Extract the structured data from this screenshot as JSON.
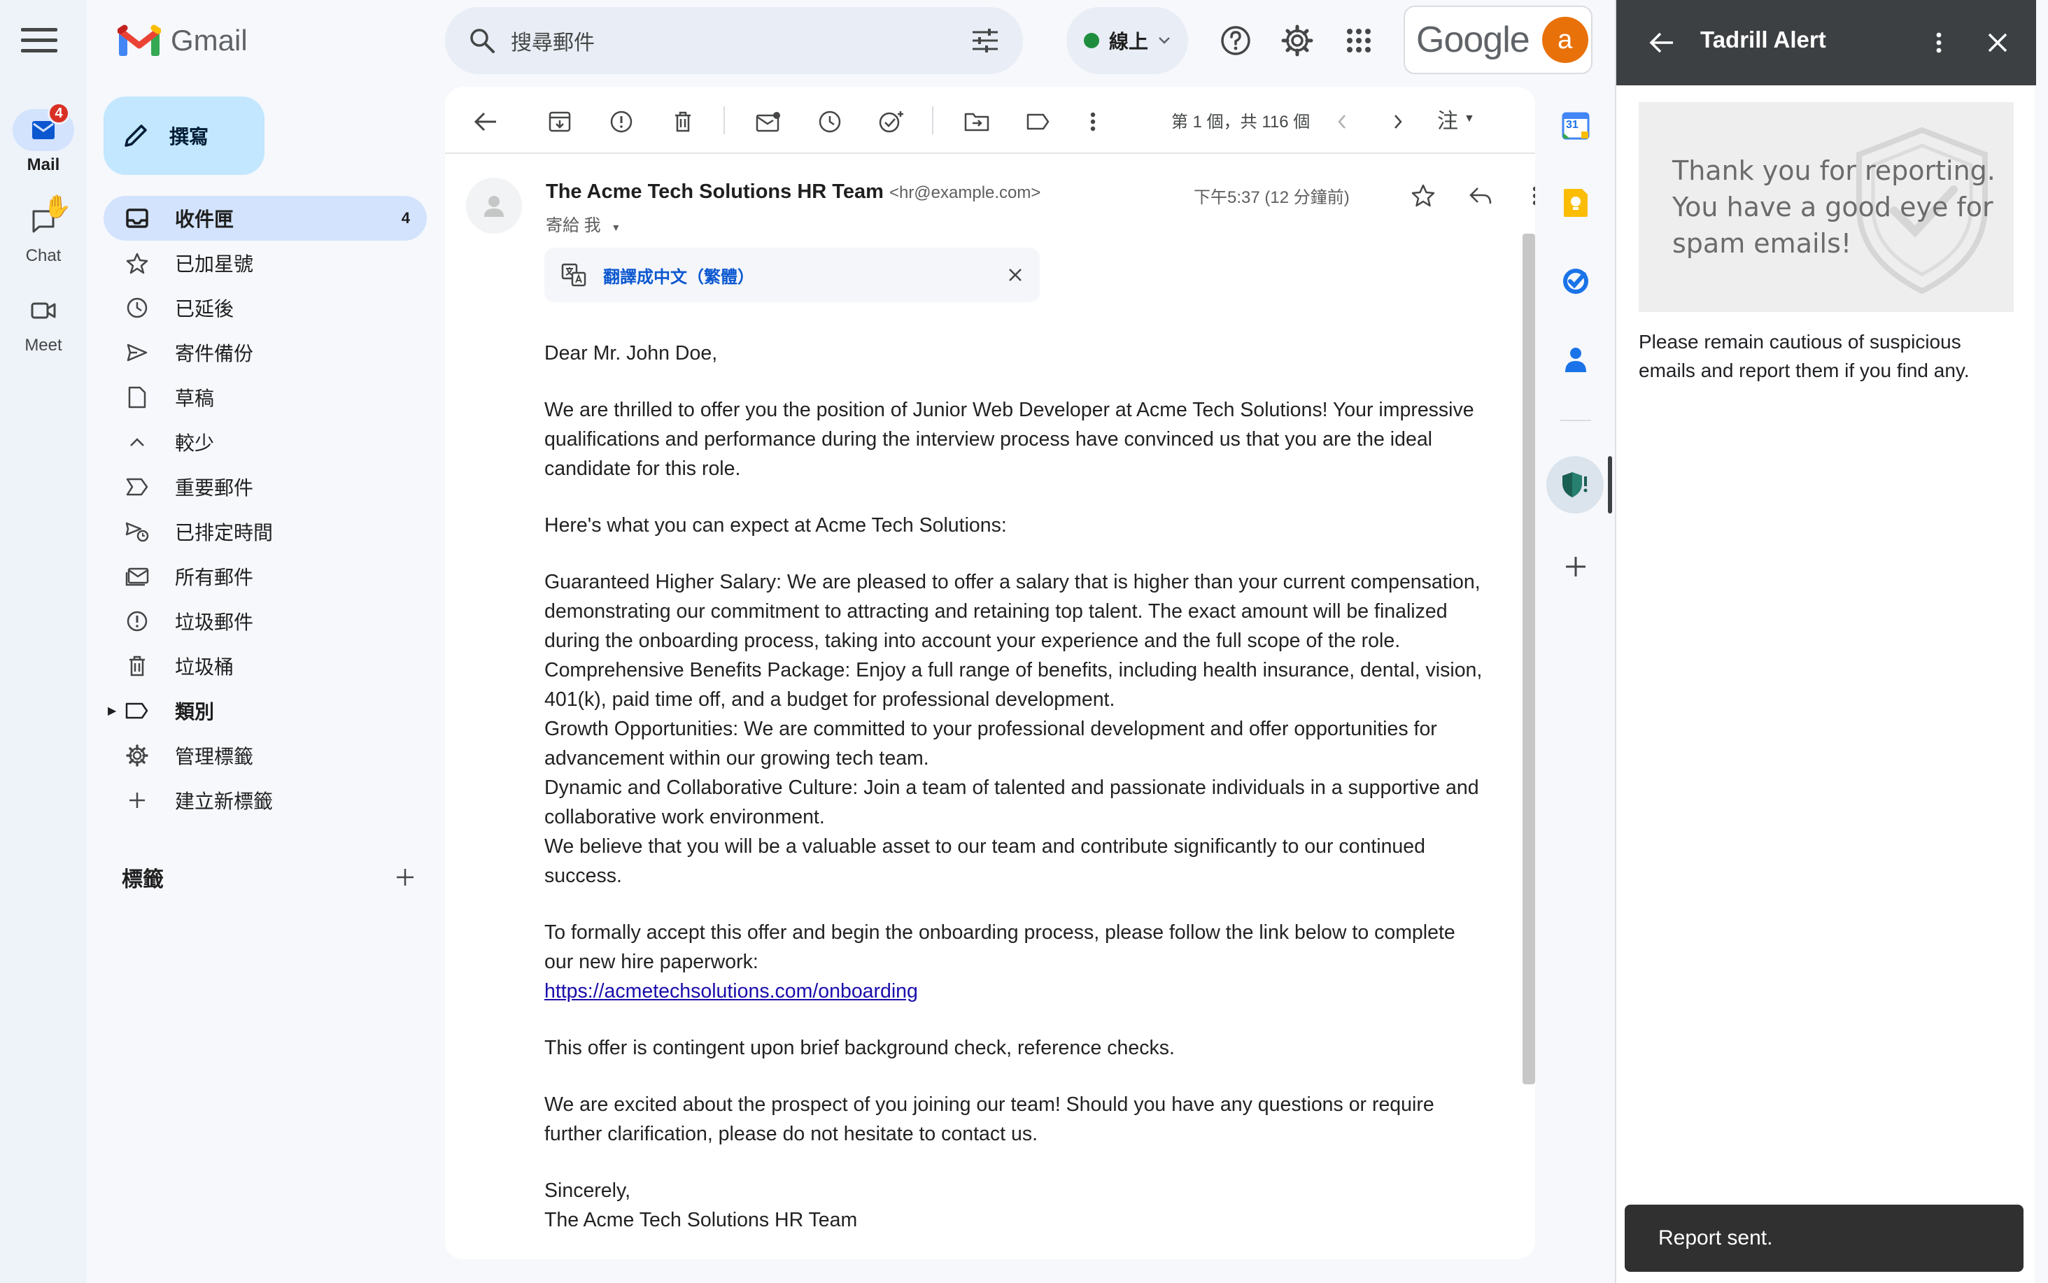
{
  "rail": {
    "items": [
      {
        "label": "Mail",
        "badge": "4"
      },
      {
        "label": "Chat"
      },
      {
        "label": "Meet"
      }
    ]
  },
  "app": {
    "name": "Gmail"
  },
  "compose": {
    "label": "撰寫"
  },
  "nav": {
    "items": [
      {
        "label": "收件匣",
        "count": "4"
      },
      {
        "label": "已加星號"
      },
      {
        "label": "已延後"
      },
      {
        "label": "寄件備份"
      },
      {
        "label": "草稿"
      },
      {
        "label": "較少"
      },
      {
        "label": "重要郵件"
      },
      {
        "label": "已排定時間"
      },
      {
        "label": "所有郵件"
      },
      {
        "label": "垃圾郵件"
      },
      {
        "label": "垃圾桶"
      },
      {
        "label": "類別"
      },
      {
        "label": "管理標籤"
      },
      {
        "label": "建立新標籤"
      }
    ],
    "labels_heading": "標籤"
  },
  "search": {
    "placeholder": "搜尋郵件"
  },
  "status": {
    "label": "線上",
    "color": "#1e8e3e"
  },
  "account": {
    "brand": "Google",
    "avatar_letter": "a",
    "avatar_color": "#e8710a"
  },
  "toolbar": {
    "pager": "第 1 個，共 116 個",
    "lang": "注"
  },
  "message": {
    "sender_name": "The Acme Tech Solutions HR Team",
    "sender_email": "<hr@example.com>",
    "to": "寄給 我",
    "time": "下午5:37 (12 分鐘前)",
    "translate_label": "翻譯成中文（繁體）",
    "greeting": "Dear Mr. John Doe,",
    "p1": "We are thrilled to offer you the position of Junior Web Developer at Acme Tech Solutions! Your impressive qualifications and performance during the interview process have convinced us that you are the ideal candidate for this role.",
    "p2": "Here's what you can expect at Acme Tech Solutions:",
    "b1": "Guaranteed Higher Salary: We are pleased to offer a salary that is higher than your current compensation, demonstrating our commitment to attracting and retaining top talent. The exact amount will be finalized during the onboarding process, taking into account your experience and the full scope of the role.",
    "b2": "Comprehensive Benefits Package: Enjoy a full range of benefits, including health insurance, dental, vision, 401(k), paid time off, and a budget for professional development.",
    "b3": "Growth Opportunities: We are committed to your professional development and offer opportunities for advancement within our growing tech team.",
    "b4": "Dynamic and Collaborative Culture: Join a team of talented and passionate individuals in a supportive and collaborative work environment.",
    "b5": "We believe that you will be a valuable asset to our team and contribute significantly to our continued success.",
    "p3": "To formally accept this offer and begin the onboarding process, please follow the link below to complete our new hire paperwork:",
    "link": "https://acmetechsolutions.com/onboarding",
    "p4": "This offer is contingent upon brief background check, reference checks.",
    "p5": "We are excited about the prospect of you joining our team! Should you have any questions or require further clarification, please do not hesitate to contact us.",
    "closing": "Sincerely,",
    "signature": "The Acme Tech Solutions HR Team"
  },
  "sidestrip": {
    "calendar_day": "31"
  },
  "panel": {
    "title": "Tadrill Alert",
    "thanks_line1": "Thank you for reporting.",
    "thanks_line2": "You have a good eye for",
    "thanks_line3": "spam emails!",
    "caution": "Please remain cautious of suspicious emails and report them if you find any."
  },
  "snackbar": {
    "text": "Report sent."
  }
}
